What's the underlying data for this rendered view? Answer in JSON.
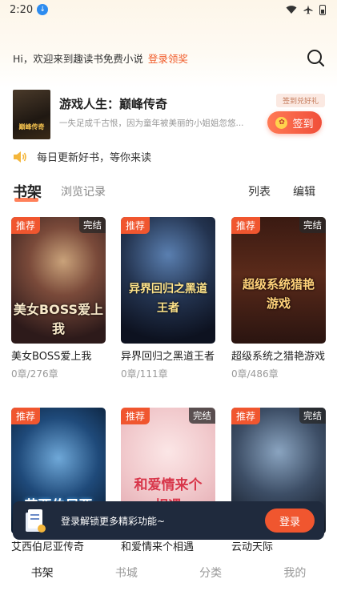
{
  "status_bar": {
    "time": "2:20"
  },
  "header": {
    "greeting": "Hi，欢迎来到趣读书免费小说",
    "login_link": "登录领奖"
  },
  "banner": {
    "cover_text": "巅峰传奇",
    "title": "游戏人生：巅峰传奇",
    "description": "一失足成千古恨，因为童年被美丽的小姐姐忽悠...",
    "sign_tag": "签到兑好礼",
    "sign_button": "签到"
  },
  "notice": {
    "text": "每日更新好书，等你来读"
  },
  "tabs": {
    "shelf": "书架",
    "history": "浏览记录",
    "list": "列表",
    "edit": "编辑"
  },
  "books": [
    {
      "title": "美女BOSS爱上我",
      "chapters": "0章/276章",
      "recommended": "推荐",
      "status": "完结",
      "cover_text": "美女BOSS爱上我"
    },
    {
      "title": "异界回归之黑道王者",
      "chapters": "0章/111章",
      "recommended": "推荐",
      "status": "",
      "cover_text": "异界回归之黑道王者"
    },
    {
      "title": "超级系统之猎艳游戏",
      "chapters": "0章/486章",
      "recommended": "推荐",
      "status": "完结",
      "cover_text": "超级系统猎艳游戏"
    },
    {
      "title": "艾西伯尼亚传奇",
      "chapters": "",
      "recommended": "推荐",
      "status": "",
      "cover_text": "艾西伯尼亚"
    },
    {
      "title": "和爱情来个相遇",
      "chapters": "",
      "recommended": "推荐",
      "status": "完结",
      "cover_text": "和爱情来个相遇"
    },
    {
      "title": "云动天际",
      "chapters": "",
      "recommended": "推荐",
      "status": "完结",
      "cover_text": ""
    }
  ],
  "toast": {
    "text": "登录解锁更多精彩功能~",
    "button": "登录"
  },
  "bottom_nav": {
    "items": [
      "书架",
      "书城",
      "分类",
      "我的"
    ]
  },
  "colors": {
    "accent": "#f0562f",
    "toast_bg": "#1f2a3d"
  }
}
